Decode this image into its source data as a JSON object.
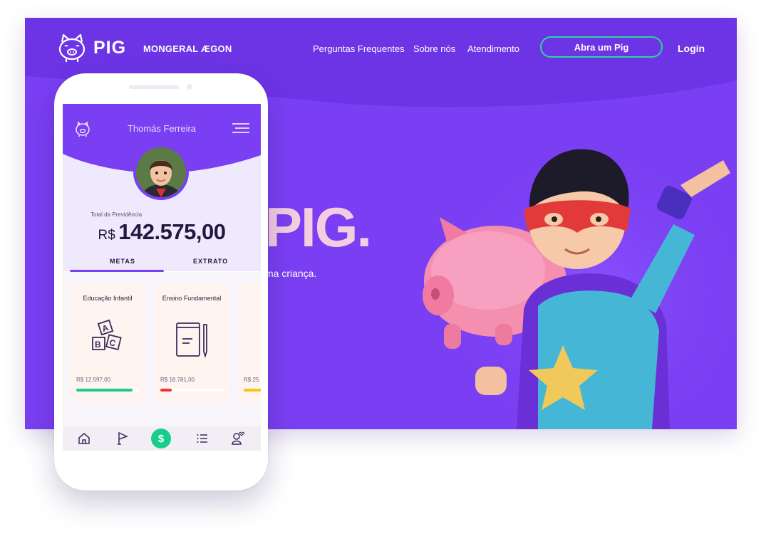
{
  "site": {
    "brand": "PIG",
    "partner": "MONGERAL ÆGON",
    "nav": {
      "faq": "Perguntas Frequentes",
      "about": "Sobre nós",
      "support": "Atendimento"
    },
    "cta": "Abra um Pig",
    "login": "Login",
    "hero_title": "PIG.",
    "hero_subtitle": "ma criança.",
    "colors": {
      "background": "#7a3ff2",
      "header": "#6c34e4",
      "accent": "#28d6a0",
      "title": "#f5cde0"
    }
  },
  "app": {
    "user_name": "Thomás Ferreira",
    "total_label": "Total da Previdência",
    "total_currency": "R$",
    "total_value": "142.575,00",
    "tabs": {
      "metas": "METAS",
      "extrato": "EXTRATO"
    },
    "goals": [
      {
        "title": "Educação Infantil",
        "amount": "R$ 12.597,00",
        "progress": 0.88,
        "color": "#18cf8a",
        "icon": "abc-blocks-icon"
      },
      {
        "title": "Ensino Fundamental",
        "amount": "R$ 18.781,00",
        "progress": 0.18,
        "color": "#f0343c",
        "icon": "notebook-icon"
      },
      {
        "title": "",
        "amount": "R$ 25",
        "progress": 0.9,
        "color": "#f5c518",
        "icon": ""
      }
    ],
    "bottom_nav": [
      "home-icon",
      "flag-icon",
      "dollar-icon",
      "list-icon",
      "profile-icon"
    ],
    "dollar_symbol": "$"
  }
}
